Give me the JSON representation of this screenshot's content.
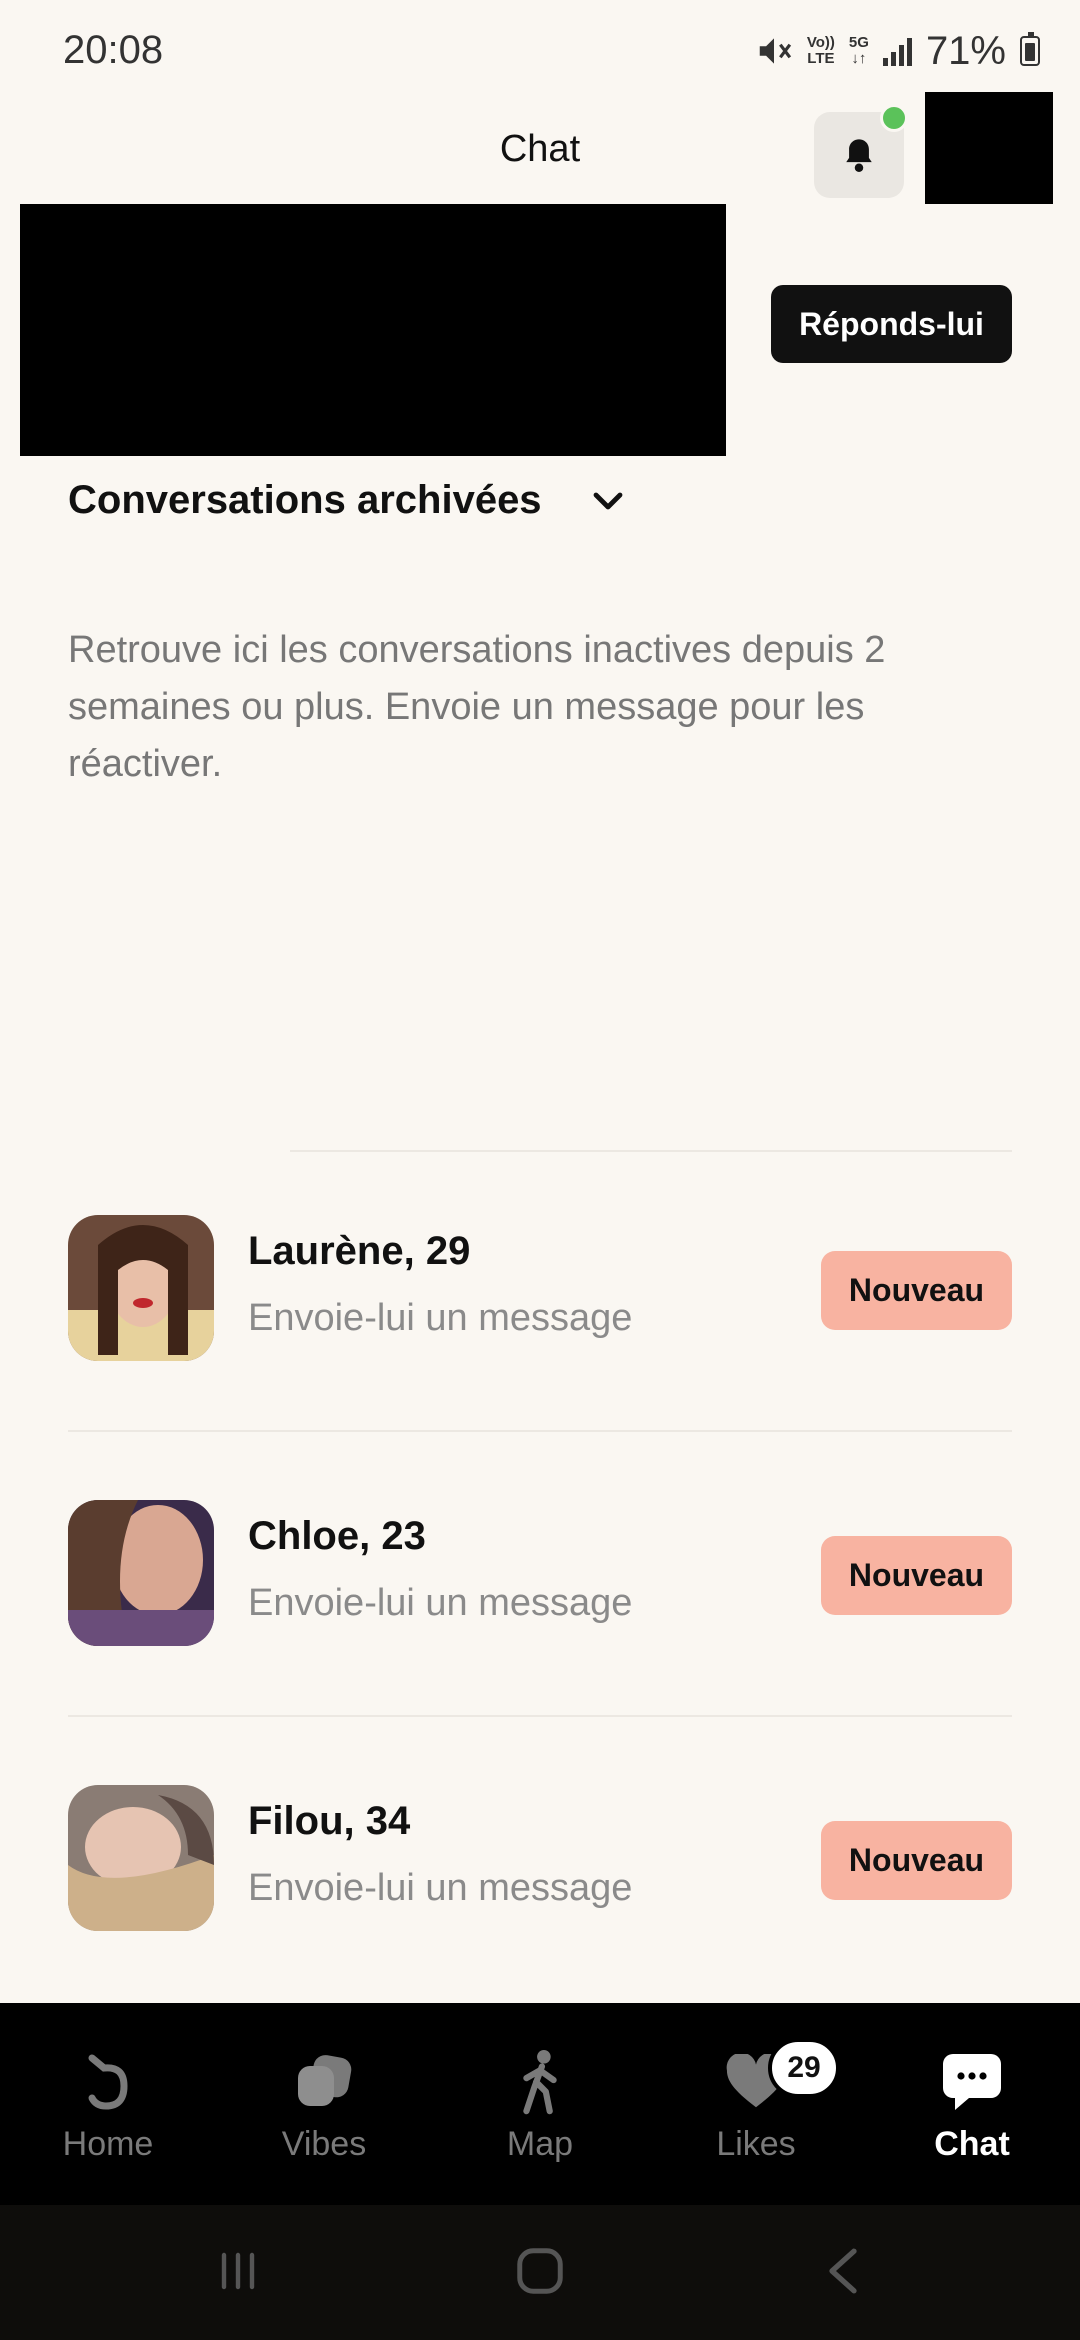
{
  "status_bar": {
    "time": "20:08",
    "network_top": "Vo))",
    "network_bottom": "LTE",
    "gen_top": "5G",
    "gen_bottom": "↓↑",
    "battery": "71%"
  },
  "header": {
    "title": "Chat",
    "notification_icon": "bell-icon",
    "notification_dot_color": "#5BC25A"
  },
  "banner": {
    "reply_label": "Réponds-lui"
  },
  "archive": {
    "title": "Conversations archivées",
    "description": "Retrouve ici les conversations inactives depuis 2 semaines ou plus. Envoie un message pour les réactiver."
  },
  "conversations": [
    {
      "name": "Laurène, 29",
      "subtitle": "Envoie-lui un message",
      "badge": "Nouveau"
    },
    {
      "name": "Chloe, 23",
      "subtitle": "Envoie-lui un message",
      "badge": "Nouveau"
    },
    {
      "name": "Filou, 34",
      "subtitle": "Envoie-lui un message",
      "badge": "Nouveau"
    }
  ],
  "nav": {
    "items": [
      {
        "label": "Home",
        "icon": "home-icon"
      },
      {
        "label": "Vibes",
        "icon": "vibes-icon"
      },
      {
        "label": "Map",
        "icon": "walking-person-icon"
      },
      {
        "label": "Likes",
        "icon": "heart-icon"
      },
      {
        "label": "Chat",
        "icon": "chat-bubble-icon"
      }
    ],
    "active": "Chat",
    "likes_count": "29"
  },
  "colors": {
    "background": "#FAF7F2",
    "badge": "#F8B3A1",
    "nav_background": "#000000"
  }
}
